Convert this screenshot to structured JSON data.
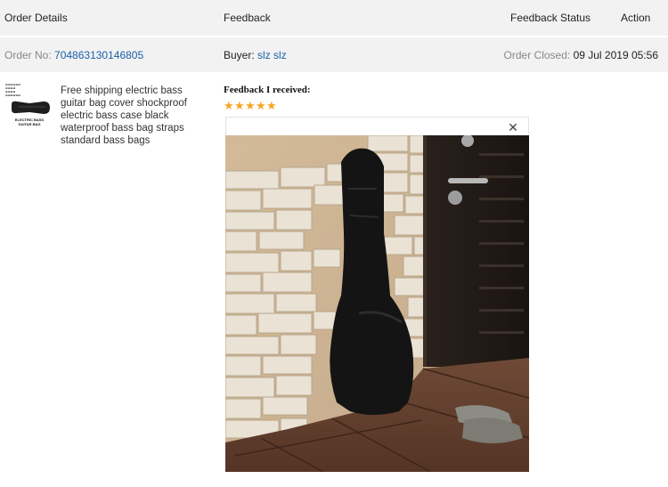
{
  "header": {
    "order_details": "Order Details",
    "feedback": "Feedback",
    "feedback_status": "Feedback Status",
    "action": "Action"
  },
  "order": {
    "order_no_label": "Order No:",
    "order_no": "704863130146805",
    "buyer_label": "Buyer:",
    "buyer_name": "slz slz",
    "closed_label": "Order Closed:",
    "closed_date": "09 Jul 2019 05:56"
  },
  "product": {
    "title": "Free shipping electric bass guitar bag cover shockproof electric bass case black waterproof bass bag straps standard bass bags",
    "thumb_caption": "ELECTRIC BASS GUITAR BAG"
  },
  "feedback": {
    "label": "Feedback I received:",
    "rating": 5,
    "rating_max": 5,
    "star_color": "#f5a623",
    "close_glyph": "✕"
  },
  "colors": {
    "link": "#1a5fa8",
    "header_bg": "#f2f2f2"
  }
}
